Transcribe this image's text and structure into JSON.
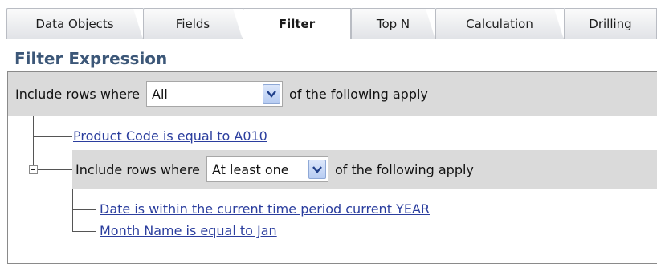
{
  "tabs": [
    {
      "label": "Data Objects",
      "active": false
    },
    {
      "label": "Fields",
      "active": false
    },
    {
      "label": "Filter",
      "active": true
    },
    {
      "label": "Top N",
      "active": false
    },
    {
      "label": "Calculation",
      "active": false
    },
    {
      "label": "Drilling",
      "active": false
    }
  ],
  "section_title": "Filter Expression",
  "root_group": {
    "prefix": "Include rows where",
    "select_value": "All",
    "suffix": "of the following apply"
  },
  "conditions": [
    {
      "text": "Product Code  is equal to  A010"
    }
  ],
  "nested_group": {
    "prefix": "Include rows where",
    "select_value": "At least one",
    "suffix": "of the following apply",
    "conditions": [
      {
        "text": "Date  is within the current time period  current YEAR"
      },
      {
        "text": "Month Name  is equal to  Jan"
      }
    ]
  },
  "icons": {
    "dropdown": "chevron-down-icon",
    "collapse": "minus-box-icon"
  },
  "colors": {
    "title": "#3c5778",
    "link": "#2b3e9e",
    "group_bar": "#dadada",
    "dropdown_button": "#b7ccf2"
  }
}
